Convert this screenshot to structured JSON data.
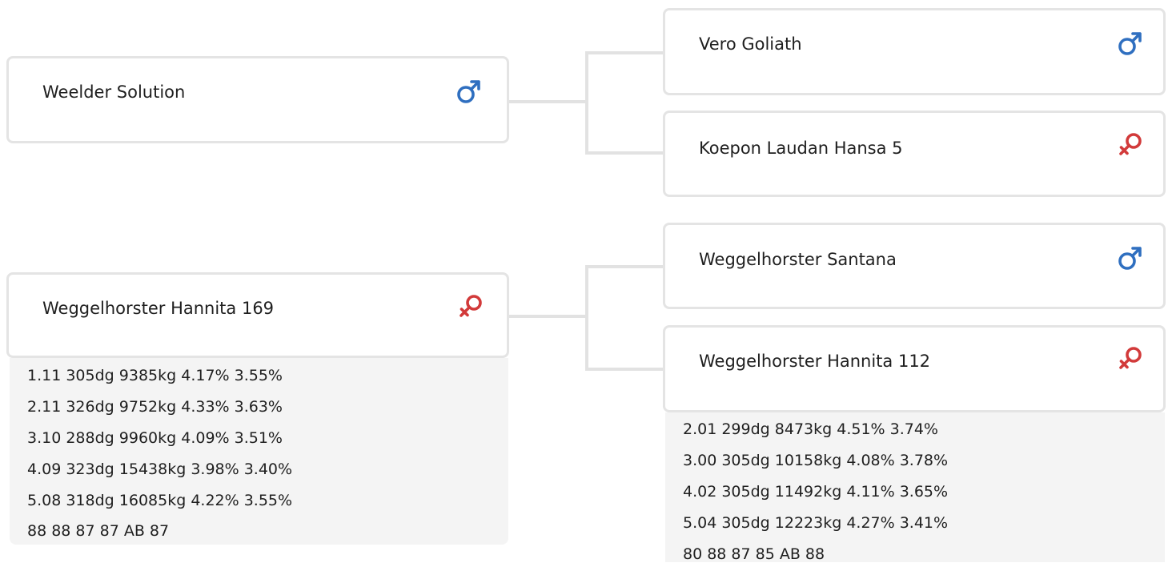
{
  "pedigree": {
    "sire": {
      "name": "Weelder Solution",
      "sex": "male",
      "sire": {
        "name": "Vero Goliath",
        "sex": "male"
      },
      "dam": {
        "name": "Koepon Laudan Hansa 5",
        "sex": "female"
      }
    },
    "dam": {
      "name": "Weggelhorster Hannita 169",
      "sex": "female",
      "stats": [
        "1.11 305dg 9385kg 4.17% 3.55%",
        "2.11 326dg 9752kg 4.33% 3.63%",
        "3.10 288dg 9960kg 4.09% 3.51%",
        "4.09 323dg 15438kg 3.98% 3.40%",
        "5.08 318dg 16085kg 4.22% 3.55%",
        "88 88 87 87 AB 87"
      ],
      "sire": {
        "name": "Weggelhorster Santana",
        "sex": "male"
      },
      "dam": {
        "name": "Weggelhorster Hannita 112",
        "sex": "female",
        "stats": [
          "2.01 299dg 8473kg 4.51% 3.74%",
          "3.00 305dg 10158kg 4.08% 3.78%",
          "4.02 305dg 11492kg 4.11% 3.65%",
          "5.04 305dg 12223kg 4.27% 3.41%",
          "80 88 87 85 AB 88"
        ]
      }
    }
  },
  "colors": {
    "male": "#2f6fc0",
    "female": "#d23a3a",
    "card_border": "#e4e4e4",
    "stats_background": "#f4f4f4",
    "connector": "#e2e2e2"
  },
  "icons": {
    "male": "male-symbol-icon",
    "female": "female-symbol-icon"
  }
}
